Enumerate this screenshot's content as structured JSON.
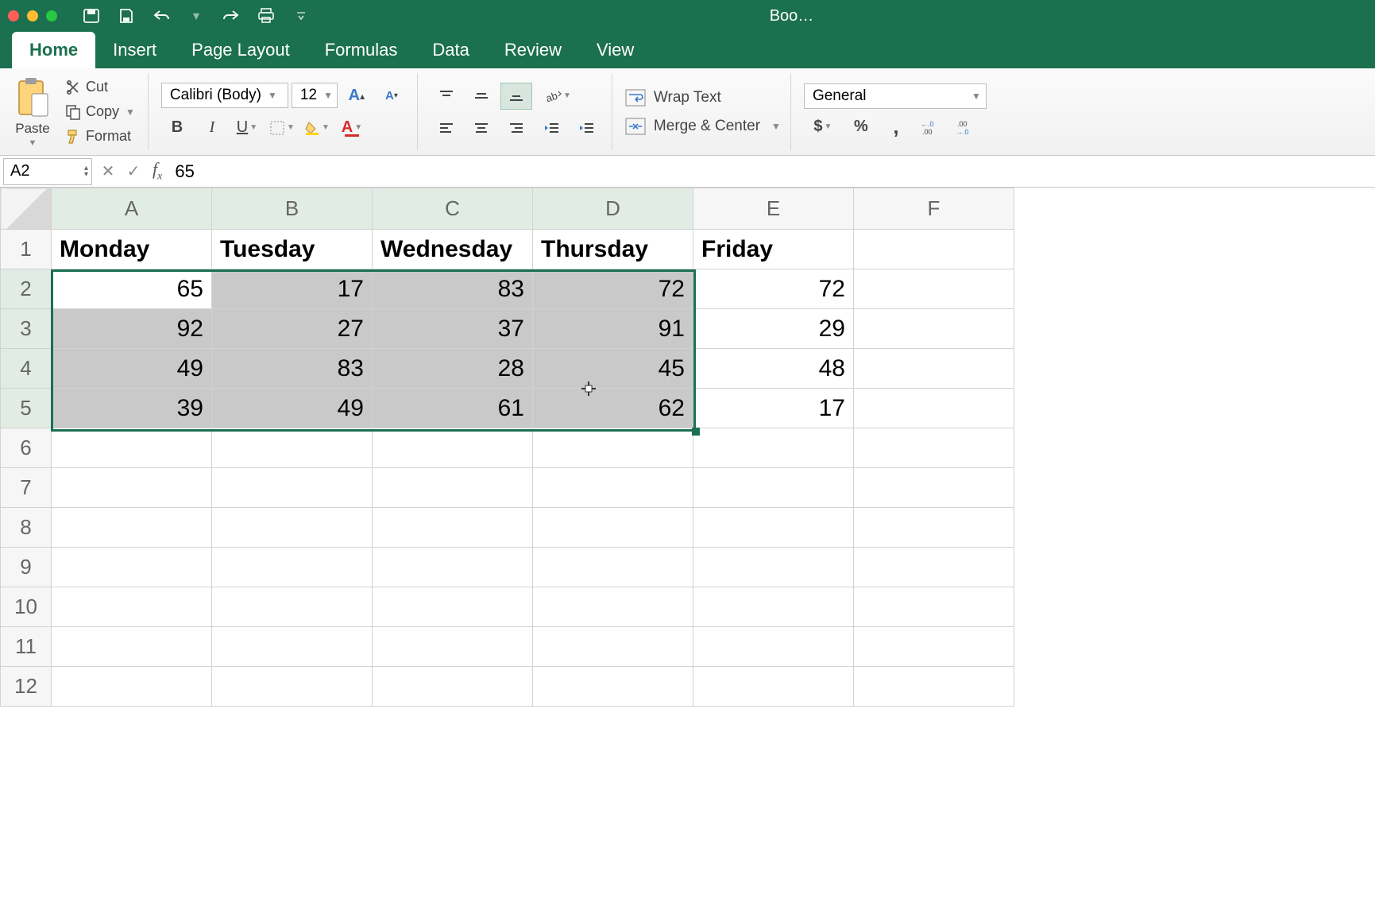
{
  "titlebar": {
    "document_title": "Boo…"
  },
  "tabs": {
    "items": [
      "Home",
      "Insert",
      "Page Layout",
      "Formulas",
      "Data",
      "Review",
      "View"
    ],
    "active": "Home"
  },
  "ribbon": {
    "paste_label": "Paste",
    "cut_label": "Cut",
    "copy_label": "Copy",
    "format_label": "Format",
    "font_name": "Calibri (Body)",
    "font_size": "12",
    "wrap_text_label": "Wrap Text",
    "merge_center_label": "Merge & Center",
    "number_format": "General"
  },
  "formula_bar": {
    "cell_ref": "A2",
    "formula": "65"
  },
  "grid": {
    "columns": [
      "A",
      "B",
      "C",
      "D",
      "E",
      "F"
    ],
    "row_numbers": [
      1,
      2,
      3,
      4,
      5,
      6,
      7,
      8,
      9,
      10,
      11,
      12
    ],
    "headers": [
      "Monday",
      "Tuesday",
      "Wednesday",
      "Thursday",
      "Friday"
    ],
    "data": [
      [
        65,
        17,
        83,
        72,
        72
      ],
      [
        92,
        27,
        37,
        91,
        29
      ],
      [
        49,
        83,
        28,
        45,
        48
      ],
      [
        39,
        49,
        61,
        62,
        17
      ]
    ],
    "selected_cols": [
      "A",
      "B",
      "C",
      "D"
    ],
    "selected_rows": [
      2,
      3,
      4,
      5
    ],
    "active_cell": "A2"
  },
  "chart_data": {
    "type": "table",
    "categories": [
      "Monday",
      "Tuesday",
      "Wednesday",
      "Thursday",
      "Friday"
    ],
    "series": [
      {
        "name": "row2",
        "values": [
          65,
          17,
          83,
          72,
          72
        ]
      },
      {
        "name": "row3",
        "values": [
          92,
          27,
          37,
          91,
          29
        ]
      },
      {
        "name": "row4",
        "values": [
          49,
          83,
          28,
          45,
          48
        ]
      },
      {
        "name": "row5",
        "values": [
          39,
          49,
          61,
          62,
          17
        ]
      }
    ],
    "title": "",
    "xlabel": "",
    "ylabel": ""
  }
}
